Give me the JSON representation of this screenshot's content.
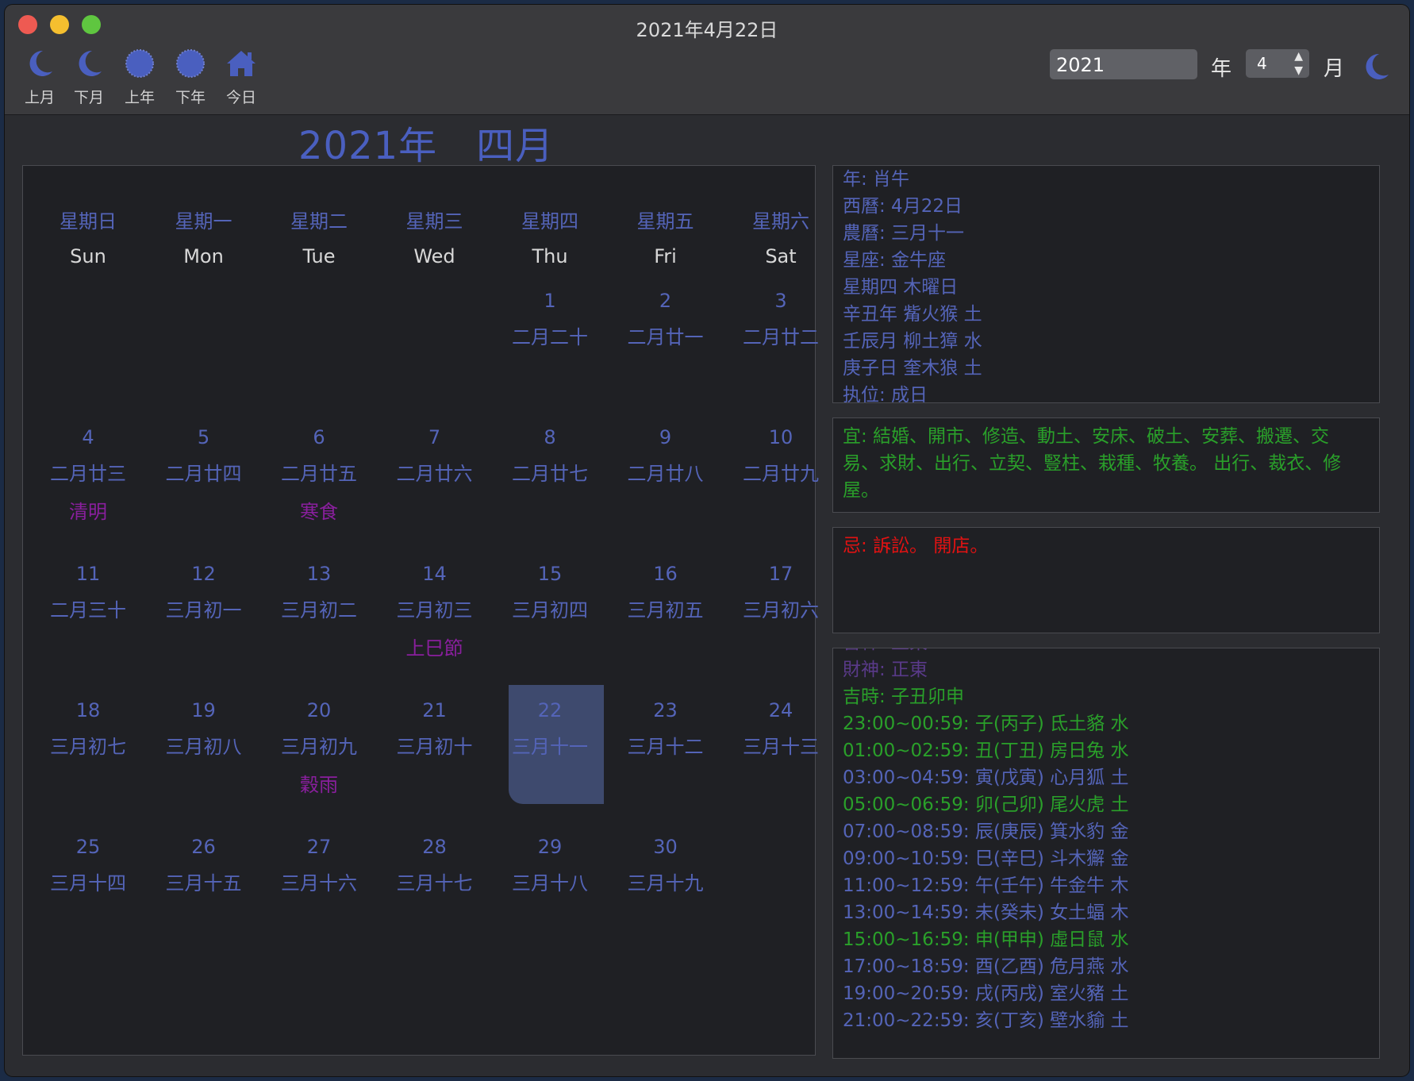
{
  "window": {
    "title": "2021年4月22日"
  },
  "toolbar": {
    "prev_month": "上月",
    "next_month": "下月",
    "prev_year": "上年",
    "next_year": "下年",
    "today": "今日",
    "year_value": "2021",
    "year_label": "年",
    "month_value": "4",
    "month_label": "月"
  },
  "calendar": {
    "title": "2021年　四月",
    "weekdays": [
      {
        "zh": "星期日",
        "en": "Sun"
      },
      {
        "zh": "星期一",
        "en": "Mon"
      },
      {
        "zh": "星期二",
        "en": "Tue"
      },
      {
        "zh": "星期三",
        "en": "Wed"
      },
      {
        "zh": "星期四",
        "en": "Thu"
      },
      {
        "zh": "星期五",
        "en": "Fri"
      },
      {
        "zh": "星期六",
        "en": "Sat"
      }
    ],
    "first_weekday": 4,
    "selected_day": 22,
    "days": [
      {
        "day": "1",
        "lunar": "二月二十"
      },
      {
        "day": "2",
        "lunar": "二月廿一"
      },
      {
        "day": "3",
        "lunar": "二月廿二"
      },
      {
        "day": "4",
        "lunar": "二月廿三",
        "festival": "清明"
      },
      {
        "day": "5",
        "lunar": "二月廿四"
      },
      {
        "day": "6",
        "lunar": "二月廿五",
        "festival": "寒食"
      },
      {
        "day": "7",
        "lunar": "二月廿六"
      },
      {
        "day": "8",
        "lunar": "二月廿七"
      },
      {
        "day": "9",
        "lunar": "二月廿八"
      },
      {
        "day": "10",
        "lunar": "二月廿九"
      },
      {
        "day": "11",
        "lunar": "二月三十"
      },
      {
        "day": "12",
        "lunar": "三月初一"
      },
      {
        "day": "13",
        "lunar": "三月初二"
      },
      {
        "day": "14",
        "lunar": "三月初三",
        "festival": "上巳節"
      },
      {
        "day": "15",
        "lunar": "三月初四"
      },
      {
        "day": "16",
        "lunar": "三月初五"
      },
      {
        "day": "17",
        "lunar": "三月初六"
      },
      {
        "day": "18",
        "lunar": "三月初七"
      },
      {
        "day": "19",
        "lunar": "三月初八"
      },
      {
        "day": "20",
        "lunar": "三月初九",
        "festival": "穀雨"
      },
      {
        "day": "21",
        "lunar": "三月初十"
      },
      {
        "day": "22",
        "lunar": "三月十一"
      },
      {
        "day": "23",
        "lunar": "三月十二"
      },
      {
        "day": "24",
        "lunar": "三月十三"
      },
      {
        "day": "25",
        "lunar": "三月十四"
      },
      {
        "day": "26",
        "lunar": "三月十五"
      },
      {
        "day": "27",
        "lunar": "三月十六"
      },
      {
        "day": "28",
        "lunar": "三月十七"
      },
      {
        "day": "29",
        "lunar": "三月十八"
      },
      {
        "day": "30",
        "lunar": "三月十九"
      }
    ]
  },
  "info": [
    " 年: 肖牛",
    "西曆: 4月22日",
    "農曆: 三月十一",
    "星座: 金牛座",
    "星期四 木曜日",
    "辛丑年 觜火猴 土",
    "壬辰月 柳土獐 水",
    "庚子日 奎木狼 土",
    "执位: 成日"
  ],
  "yi": [
    "宜: 結婚、開市、修造、動土、安床、破土、安葬、搬遷、交",
    "易、求財、出行、立契、豎柱、栽種、牧養。 出行、裁衣、修",
    "屋。"
  ],
  "ji": "忌: 訴訟。 開店。",
  "hours": {
    "partial_top": "喜神: 正東",
    "caishen": "財神: 正東",
    "jishi": "吉時: 子丑卯申",
    "rows": [
      {
        "text": "23:00~00:59: 子(丙子) 氐土貉 水",
        "good": true
      },
      {
        "text": "01:00~02:59: 丑(丁丑) 房日兔 水",
        "good": true
      },
      {
        "text": "03:00~04:59: 寅(戊寅) 心月狐 土",
        "good": false
      },
      {
        "text": "05:00~06:59: 卯(己卯) 尾火虎 土",
        "good": true
      },
      {
        "text": "07:00~08:59: 辰(庚辰) 箕水豹 金",
        "good": false
      },
      {
        "text": "09:00~10:59: 巳(辛巳) 斗木獬 金",
        "good": false
      },
      {
        "text": "11:00~12:59: 午(壬午) 牛金牛 木",
        "good": false
      },
      {
        "text": "13:00~14:59: 未(癸未) 女土蝠 木",
        "good": false
      },
      {
        "text": "15:00~16:59: 申(甲申) 虛日鼠 水",
        "good": true
      },
      {
        "text": "17:00~18:59: 酉(乙酉) 危月燕 水",
        "good": false
      },
      {
        "text": "19:00~20:59: 戌(丙戌) 室火豬 土",
        "good": false
      },
      {
        "text": "21:00~22:59: 亥(丁亥) 壁水貐 土",
        "good": false
      }
    ]
  },
  "colors": {
    "accent": "#5464b8",
    "good": "#2aa02a",
    "bad": "#e21212",
    "festival": "#8a1f9e"
  }
}
